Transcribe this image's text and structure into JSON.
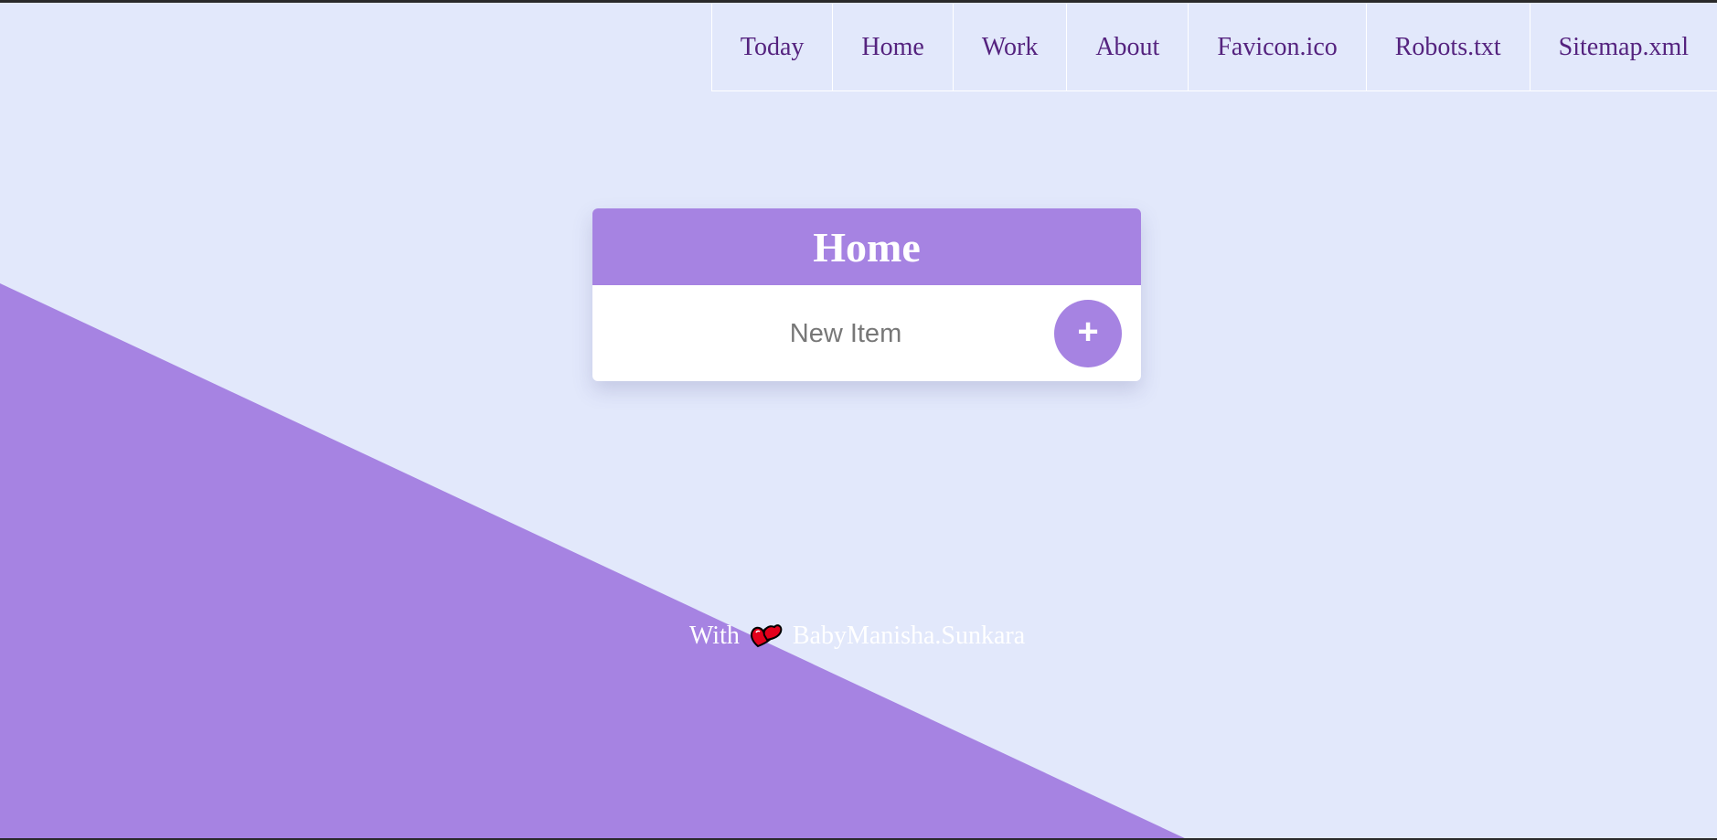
{
  "nav": {
    "items": [
      {
        "label": "Today"
      },
      {
        "label": "Home"
      },
      {
        "label": "Work"
      },
      {
        "label": "About"
      },
      {
        "label": "Favicon.ico"
      },
      {
        "label": "Robots.txt"
      },
      {
        "label": "Sitemap.xml"
      }
    ]
  },
  "card": {
    "title": "Home",
    "input_placeholder": "New Item",
    "add_button_label": "+"
  },
  "footer": {
    "prefix": "With",
    "icon": "heart-icon",
    "name": "BabyManisha.Sunkara"
  },
  "colors": {
    "background": "#e2e8fb",
    "accent": "#a683e2",
    "nav_text": "#55237f",
    "heart": "#e3001b"
  }
}
